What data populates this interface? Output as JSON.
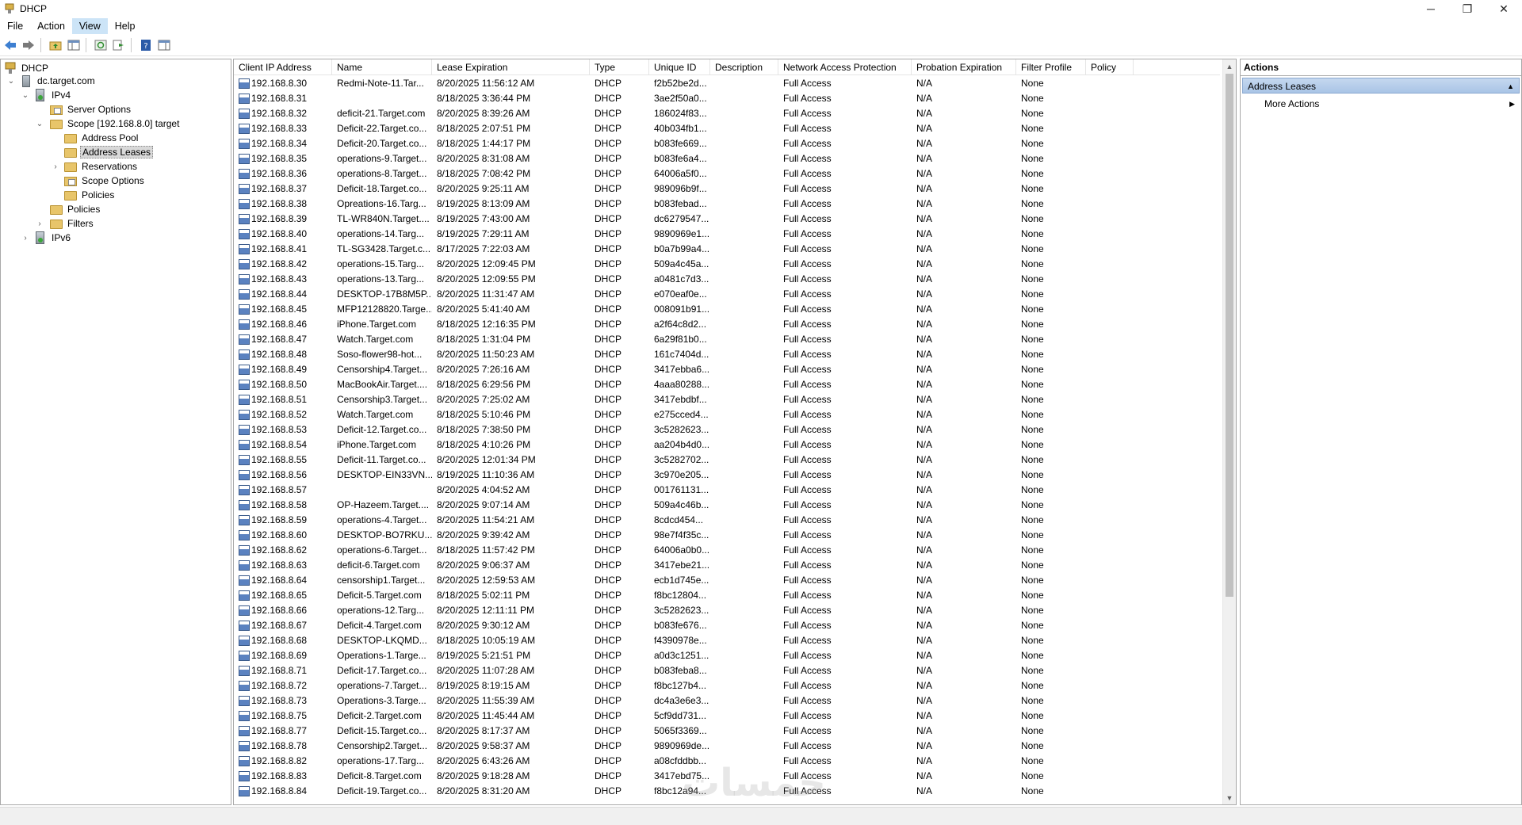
{
  "window": {
    "title": "DHCP",
    "minimize_glyph": "─",
    "restore_glyph": "❐",
    "close_glyph": "✕"
  },
  "menu": [
    "File",
    "Action",
    "View",
    "Help"
  ],
  "menu_active": "View",
  "toolbar": {
    "buttons": [
      "back-icon",
      "forward-icon",
      "up-folder-icon",
      "show-hide-tree-icon",
      "refresh-icon",
      "export-list-icon",
      "help-icon",
      "properties-icon"
    ]
  },
  "tree": {
    "nodes": [
      {
        "label": "DHCP",
        "icon": "dhcp-icon",
        "level": 0,
        "expander": ""
      },
      {
        "label": "dc.target.com",
        "icon": "server-icon",
        "level": 1,
        "expander": "⌄"
      },
      {
        "label": "IPv4",
        "icon": "ipv4-icon",
        "level": 2,
        "expander": "⌄"
      },
      {
        "label": "Server Options",
        "icon": "folder-doc-icon",
        "level": 3,
        "expander": ""
      },
      {
        "label": "Scope [192.168.8.0] target",
        "icon": "folder-icon",
        "level": 3,
        "expander": "⌄"
      },
      {
        "label": "Address Pool",
        "icon": "folder-icon",
        "level": 4,
        "expander": ""
      },
      {
        "label": "Address Leases",
        "icon": "folder-icon",
        "level": 4,
        "expander": "",
        "selected": true
      },
      {
        "label": "Reservations",
        "icon": "folder-icon",
        "level": 4,
        "expander": "›"
      },
      {
        "label": "Scope Options",
        "icon": "folder-doc-icon",
        "level": 4,
        "expander": ""
      },
      {
        "label": "Policies",
        "icon": "folder-icon",
        "level": 4,
        "expander": ""
      },
      {
        "label": "Policies",
        "icon": "folder-icon",
        "level": 3,
        "expander": ""
      },
      {
        "label": "Filters",
        "icon": "folder-icon",
        "level": 3,
        "expander": "›"
      },
      {
        "label": "IPv6",
        "icon": "ipv6-icon",
        "level": 2,
        "expander": "›"
      }
    ]
  },
  "list": {
    "columns": [
      "Client IP Address",
      "Name",
      "Lease Expiration",
      "Type",
      "Unique ID",
      "Description",
      "Network Access Protection",
      "Probation Expiration",
      "Filter Profile",
      "Policy"
    ],
    "rows": [
      [
        "192.168.8.30",
        "Redmi-Note-11.Tar...",
        "8/20/2025 11:56:12 AM",
        "DHCP",
        "f2b52be2d...",
        "",
        "Full Access",
        "N/A",
        "None",
        ""
      ],
      [
        "192.168.8.31",
        "",
        "8/18/2025 3:36:44 PM",
        "DHCP",
        "3ae2f50a0...",
        "",
        "Full Access",
        "N/A",
        "None",
        ""
      ],
      [
        "192.168.8.32",
        "deficit-21.Target.com",
        "8/20/2025 8:39:26 AM",
        "DHCP",
        "186024f83...",
        "",
        "Full Access",
        "N/A",
        "None",
        ""
      ],
      [
        "192.168.8.33",
        "Deficit-22.Target.co...",
        "8/18/2025 2:07:51 PM",
        "DHCP",
        "40b034fb1...",
        "",
        "Full Access",
        "N/A",
        "None",
        ""
      ],
      [
        "192.168.8.34",
        "Deficit-20.Target.co...",
        "8/18/2025 1:44:17 PM",
        "DHCP",
        "b083fe669...",
        "",
        "Full Access",
        "N/A",
        "None",
        ""
      ],
      [
        "192.168.8.35",
        "operations-9.Target...",
        "8/20/2025 8:31:08 AM",
        "DHCP",
        "b083fe6a4...",
        "",
        "Full Access",
        "N/A",
        "None",
        ""
      ],
      [
        "192.168.8.36",
        "operations-8.Target...",
        "8/18/2025 7:08:42 PM",
        "DHCP",
        "64006a5f0...",
        "",
        "Full Access",
        "N/A",
        "None",
        ""
      ],
      [
        "192.168.8.37",
        "Deficit-18.Target.co...",
        "8/20/2025 9:25:11 AM",
        "DHCP",
        "989096b9f...",
        "",
        "Full Access",
        "N/A",
        "None",
        ""
      ],
      [
        "192.168.8.38",
        "Opreations-16.Targ...",
        "8/19/2025 8:13:09 AM",
        "DHCP",
        "b083febad...",
        "",
        "Full Access",
        "N/A",
        "None",
        ""
      ],
      [
        "192.168.8.39",
        "TL-WR840N.Target....",
        "8/19/2025 7:43:00 AM",
        "DHCP",
        "dc6279547...",
        "",
        "Full Access",
        "N/A",
        "None",
        ""
      ],
      [
        "192.168.8.40",
        "operations-14.Targ...",
        "8/19/2025 7:29:11 AM",
        "DHCP",
        "9890969e1...",
        "",
        "Full Access",
        "N/A",
        "None",
        ""
      ],
      [
        "192.168.8.41",
        "TL-SG3428.Target.c...",
        "8/17/2025 7:22:03 AM",
        "DHCP",
        "b0a7b99a4...",
        "",
        "Full Access",
        "N/A",
        "None",
        ""
      ],
      [
        "192.168.8.42",
        "operations-15.Targ...",
        "8/20/2025 12:09:45 PM",
        "DHCP",
        "509a4c45a...",
        "",
        "Full Access",
        "N/A",
        "None",
        ""
      ],
      [
        "192.168.8.43",
        "operations-13.Targ...",
        "8/20/2025 12:09:55 PM",
        "DHCP",
        "a0481c7d3...",
        "",
        "Full Access",
        "N/A",
        "None",
        ""
      ],
      [
        "192.168.8.44",
        "DESKTOP-17B8M5P...",
        "8/20/2025 11:31:47 AM",
        "DHCP",
        "e070eaf0e...",
        "",
        "Full Access",
        "N/A",
        "None",
        ""
      ],
      [
        "192.168.8.45",
        "MFP12128820.Targe...",
        "8/20/2025 5:41:40 AM",
        "DHCP",
        "008091b91...",
        "",
        "Full Access",
        "N/A",
        "None",
        ""
      ],
      [
        "192.168.8.46",
        "iPhone.Target.com",
        "8/18/2025 12:16:35 PM",
        "DHCP",
        "a2f64c8d2...",
        "",
        "Full Access",
        "N/A",
        "None",
        ""
      ],
      [
        "192.168.8.47",
        "Watch.Target.com",
        "8/18/2025 1:31:04 PM",
        "DHCP",
        "6a29f81b0...",
        "",
        "Full Access",
        "N/A",
        "None",
        ""
      ],
      [
        "192.168.8.48",
        "Soso-flower98-hot...",
        "8/20/2025 11:50:23 AM",
        "DHCP",
        "161c7404d...",
        "",
        "Full Access",
        "N/A",
        "None",
        ""
      ],
      [
        "192.168.8.49",
        "Censorship4.Target...",
        "8/20/2025 7:26:16 AM",
        "DHCP",
        "3417ebba6...",
        "",
        "Full Access",
        "N/A",
        "None",
        ""
      ],
      [
        "192.168.8.50",
        "MacBookAir.Target....",
        "8/18/2025 6:29:56 PM",
        "DHCP",
        "4aaa80288...",
        "",
        "Full Access",
        "N/A",
        "None",
        ""
      ],
      [
        "192.168.8.51",
        "Censorship3.Target...",
        "8/20/2025 7:25:02 AM",
        "DHCP",
        "3417ebdbf...",
        "",
        "Full Access",
        "N/A",
        "None",
        ""
      ],
      [
        "192.168.8.52",
        "Watch.Target.com",
        "8/18/2025 5:10:46 PM",
        "DHCP",
        "e275cced4...",
        "",
        "Full Access",
        "N/A",
        "None",
        ""
      ],
      [
        "192.168.8.53",
        "Deficit-12.Target.co...",
        "8/18/2025 7:38:50 PM",
        "DHCP",
        "3c5282623...",
        "",
        "Full Access",
        "N/A",
        "None",
        ""
      ],
      [
        "192.168.8.54",
        "iPhone.Target.com",
        "8/18/2025 4:10:26 PM",
        "DHCP",
        "aa204b4d0...",
        "",
        "Full Access",
        "N/A",
        "None",
        ""
      ],
      [
        "192.168.8.55",
        "Deficit-11.Target.co...",
        "8/20/2025 12:01:34 PM",
        "DHCP",
        "3c5282702...",
        "",
        "Full Access",
        "N/A",
        "None",
        ""
      ],
      [
        "192.168.8.56",
        "DESKTOP-EIN33VN....",
        "8/19/2025 11:10:36 AM",
        "DHCP",
        "3c970e205...",
        "",
        "Full Access",
        "N/A",
        "None",
        ""
      ],
      [
        "192.168.8.57",
        "",
        "8/20/2025 4:04:52 AM",
        "DHCP",
        "001761131...",
        "",
        "Full Access",
        "N/A",
        "None",
        ""
      ],
      [
        "192.168.8.58",
        "OP-Hazeem.Target....",
        "8/20/2025 9:07:14 AM",
        "DHCP",
        "509a4c46b...",
        "",
        "Full Access",
        "N/A",
        "None",
        ""
      ],
      [
        "192.168.8.59",
        "operations-4.Target...",
        "8/20/2025 11:54:21 AM",
        "DHCP",
        "8cdcd454...",
        "",
        "Full Access",
        "N/A",
        "None",
        ""
      ],
      [
        "192.168.8.60",
        "DESKTOP-BO7RKU...",
        "8/20/2025 9:39:42 AM",
        "DHCP",
        "98e7f4f35c...",
        "",
        "Full Access",
        "N/A",
        "None",
        ""
      ],
      [
        "192.168.8.62",
        "operations-6.Target...",
        "8/18/2025 11:57:42 PM",
        "DHCP",
        "64006a0b0...",
        "",
        "Full Access",
        "N/A",
        "None",
        ""
      ],
      [
        "192.168.8.63",
        "deficit-6.Target.com",
        "8/20/2025 9:06:37 AM",
        "DHCP",
        "3417ebe21...",
        "",
        "Full Access",
        "N/A",
        "None",
        ""
      ],
      [
        "192.168.8.64",
        "censorship1.Target...",
        "8/20/2025 12:59:53 AM",
        "DHCP",
        "ecb1d745e...",
        "",
        "Full Access",
        "N/A",
        "None",
        ""
      ],
      [
        "192.168.8.65",
        "Deficit-5.Target.com",
        "8/18/2025 5:02:11 PM",
        "DHCP",
        "f8bc12804...",
        "",
        "Full Access",
        "N/A",
        "None",
        ""
      ],
      [
        "192.168.8.66",
        "operations-12.Targ...",
        "8/20/2025 12:11:11 PM",
        "DHCP",
        "3c5282623...",
        "",
        "Full Access",
        "N/A",
        "None",
        ""
      ],
      [
        "192.168.8.67",
        "Deficit-4.Target.com",
        "8/20/2025 9:30:12 AM",
        "DHCP",
        "b083fe676...",
        "",
        "Full Access",
        "N/A",
        "None",
        ""
      ],
      [
        "192.168.8.68",
        "DESKTOP-LKQMD...",
        "8/18/2025 10:05:19 AM",
        "DHCP",
        "f4390978e...",
        "",
        "Full Access",
        "N/A",
        "None",
        ""
      ],
      [
        "192.168.8.69",
        "Operations-1.Targe...",
        "8/19/2025 5:21:51 PM",
        "DHCP",
        "a0d3c1251...",
        "",
        "Full Access",
        "N/A",
        "None",
        ""
      ],
      [
        "192.168.8.71",
        "Deficit-17.Target.co...",
        "8/20/2025 11:07:28 AM",
        "DHCP",
        "b083feba8...",
        "",
        "Full Access",
        "N/A",
        "None",
        ""
      ],
      [
        "192.168.8.72",
        "operations-7.Target...",
        "8/19/2025 8:19:15 AM",
        "DHCP",
        "f8bc127b4...",
        "",
        "Full Access",
        "N/A",
        "None",
        ""
      ],
      [
        "192.168.8.73",
        "Operations-3.Targe...",
        "8/20/2025 11:55:39 AM",
        "DHCP",
        "dc4a3e6e3...",
        "",
        "Full Access",
        "N/A",
        "None",
        ""
      ],
      [
        "192.168.8.75",
        "Deficit-2.Target.com",
        "8/20/2025 11:45:44 AM",
        "DHCP",
        "5cf9dd731...",
        "",
        "Full Access",
        "N/A",
        "None",
        ""
      ],
      [
        "192.168.8.77",
        "Deficit-15.Target.co...",
        "8/20/2025 8:17:37 AM",
        "DHCP",
        "5065f3369...",
        "",
        "Full Access",
        "N/A",
        "None",
        ""
      ],
      [
        "192.168.8.78",
        "Censorship2.Target...",
        "8/20/2025 9:58:37 AM",
        "DHCP",
        "9890969de...",
        "",
        "Full Access",
        "N/A",
        "None",
        ""
      ],
      [
        "192.168.8.82",
        "operations-17.Targ...",
        "8/20/2025 6:43:26 AM",
        "DHCP",
        "a08cfddbb...",
        "",
        "Full Access",
        "N/A",
        "None",
        ""
      ],
      [
        "192.168.8.83",
        "Deficit-8.Target.com",
        "8/20/2025 9:18:28 AM",
        "DHCP",
        "3417ebd75...",
        "",
        "Full Access",
        "N/A",
        "None",
        ""
      ],
      [
        "192.168.8.84",
        "Deficit-19.Target.co...",
        "8/20/2025 8:31:20 AM",
        "DHCP",
        "f8bc12a94...",
        "",
        "Full Access",
        "N/A",
        "None",
        ""
      ]
    ]
  },
  "actions": {
    "title": "Actions",
    "section": "Address Leases",
    "items": [
      "More Actions"
    ]
  },
  "watermark": "خمسات"
}
